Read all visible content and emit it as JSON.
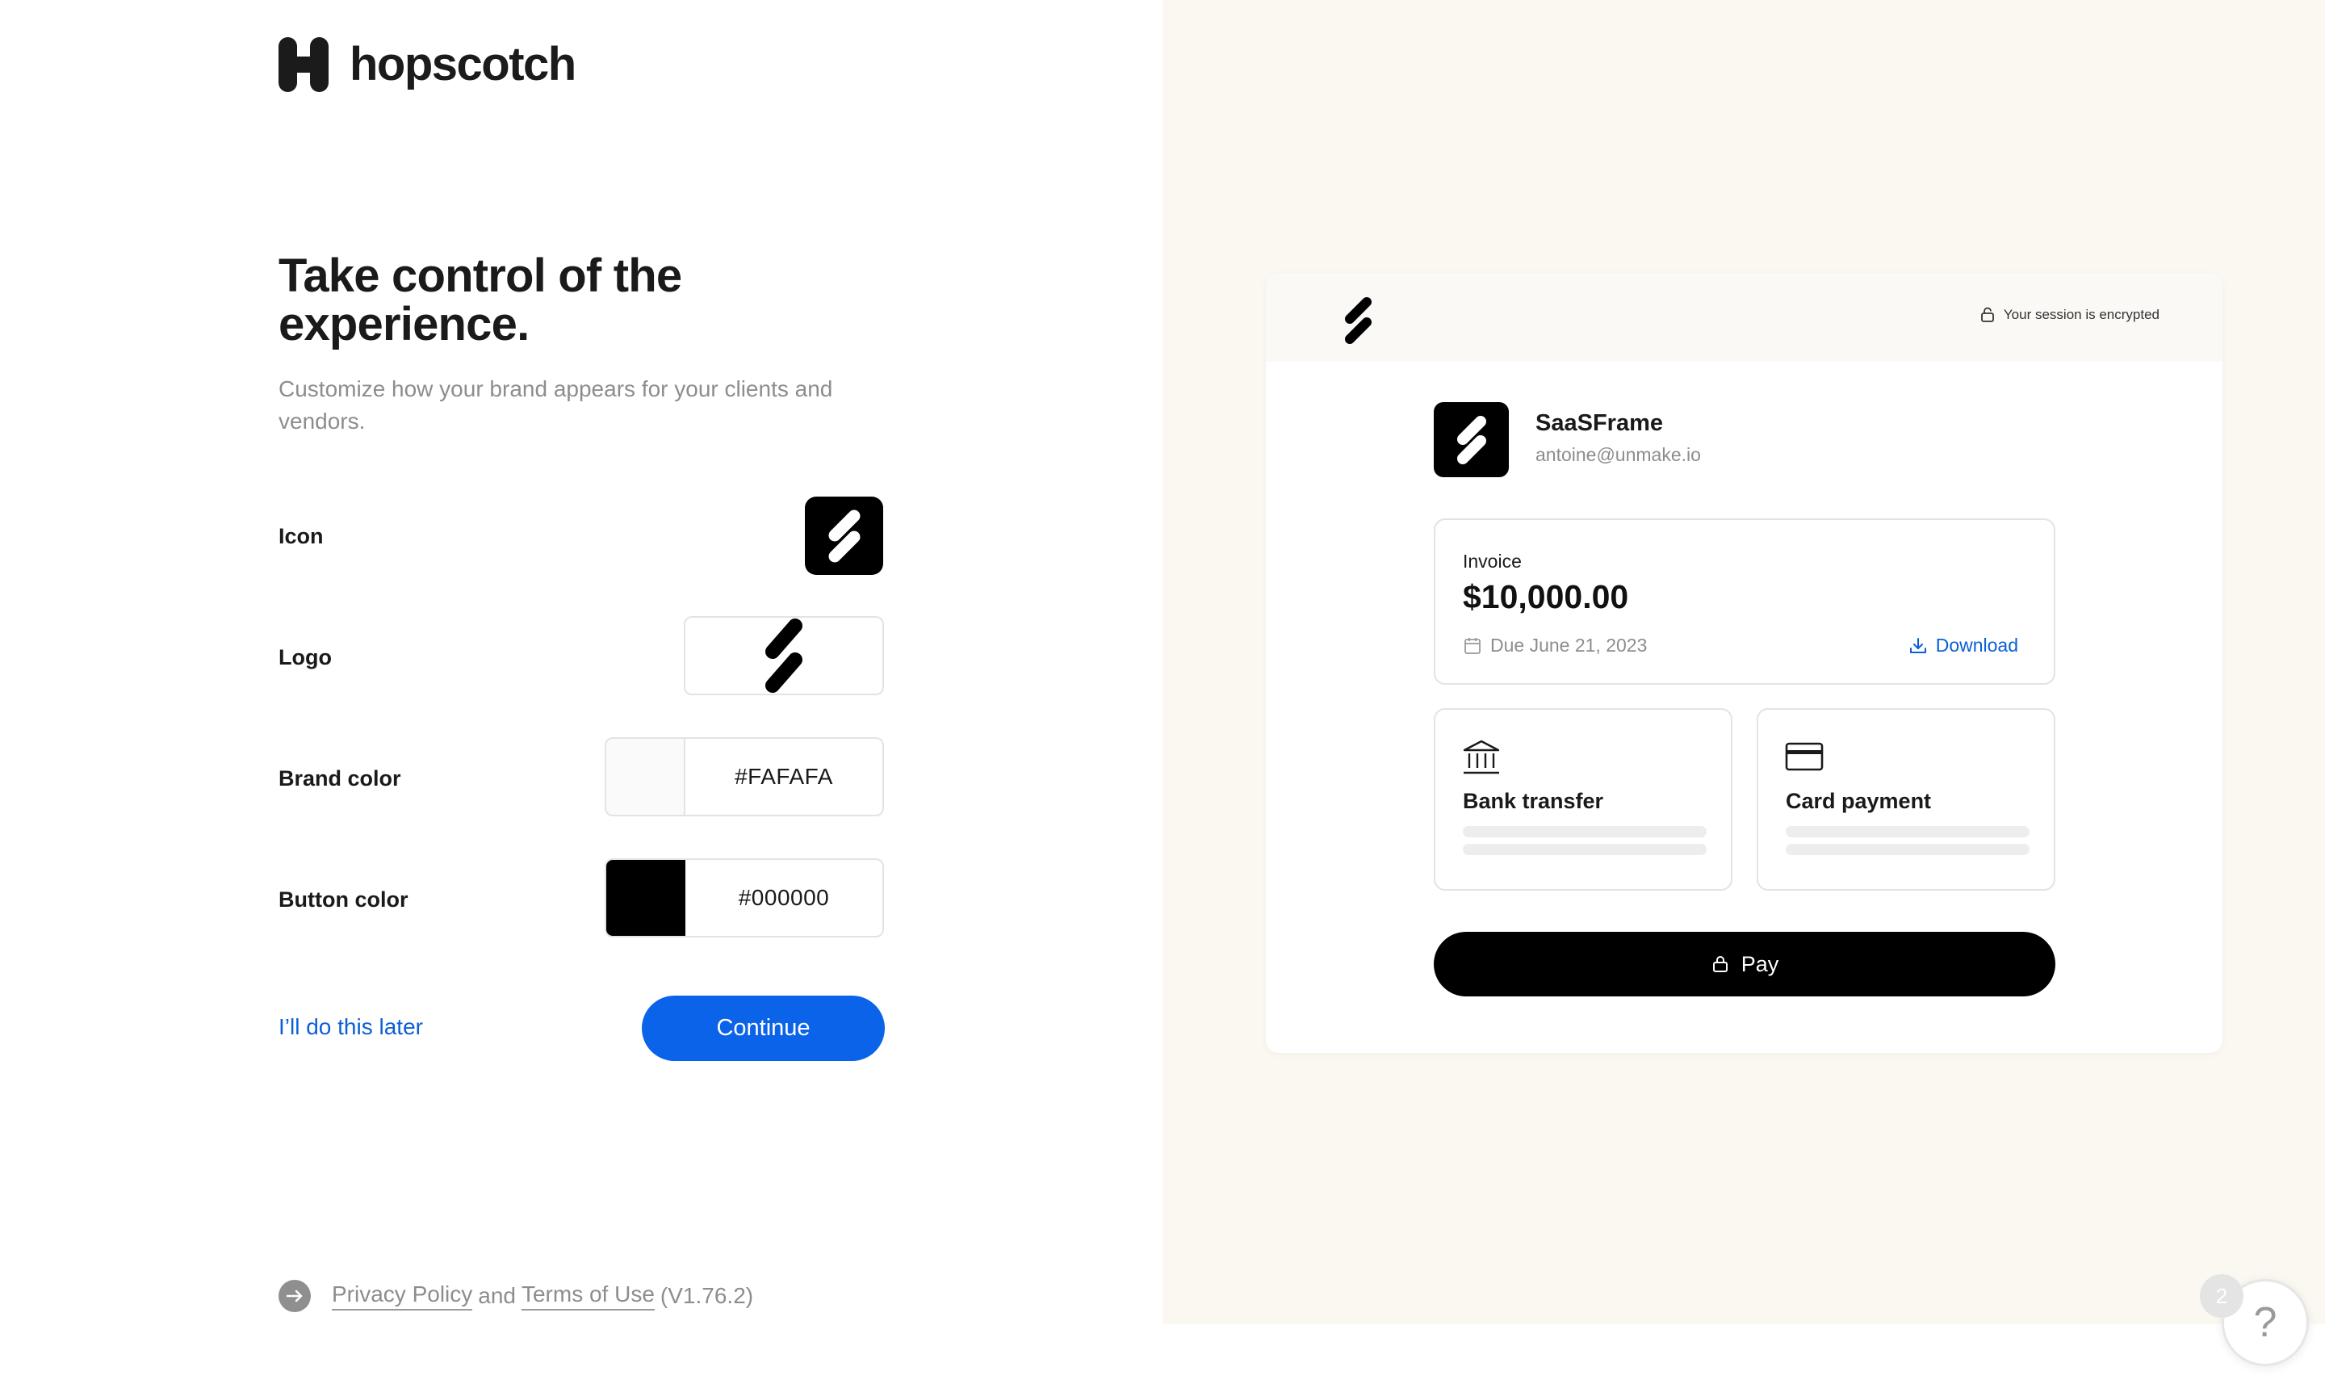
{
  "brand": {
    "name": "hopscotch",
    "logo_icon": "hopscotch-h-logo"
  },
  "onboarding": {
    "title": "Take control of the experience.",
    "subtitle": "Customize how your brand appears for your clients and vendors.",
    "icon_label": "Icon",
    "logo_label": "Logo",
    "brand_color_label": "Brand color",
    "brand_color_value": "#FAFAFA",
    "button_color_label": "Button color",
    "button_color_value": "#000000",
    "later_link": "I’ll do this later",
    "continue_label": "Continue"
  },
  "footer": {
    "privacy": "Privacy Policy",
    "and": "and",
    "terms": "Terms of Use",
    "version": "(V1.76.2)"
  },
  "preview": {
    "encrypted_text": "Your session is encrypted",
    "merchant_name": "SaaSFrame",
    "merchant_email": "antoine@unmake.io",
    "invoice_label": "Invoice",
    "invoice_amount": "$10,000.00",
    "due_date": "Due June 21, 2023",
    "download_label": "Download",
    "method_bank": "Bank transfer",
    "method_card": "Card payment",
    "pay_label": "Pay"
  },
  "help": {
    "badge_count": "2",
    "icon": "?"
  },
  "colors": {
    "accent": "#0A63E8",
    "link": "#0A5FD8",
    "preview_bg": "#FBF8F1",
    "brand_color": "#FAFAFA",
    "button_color": "#000000"
  }
}
